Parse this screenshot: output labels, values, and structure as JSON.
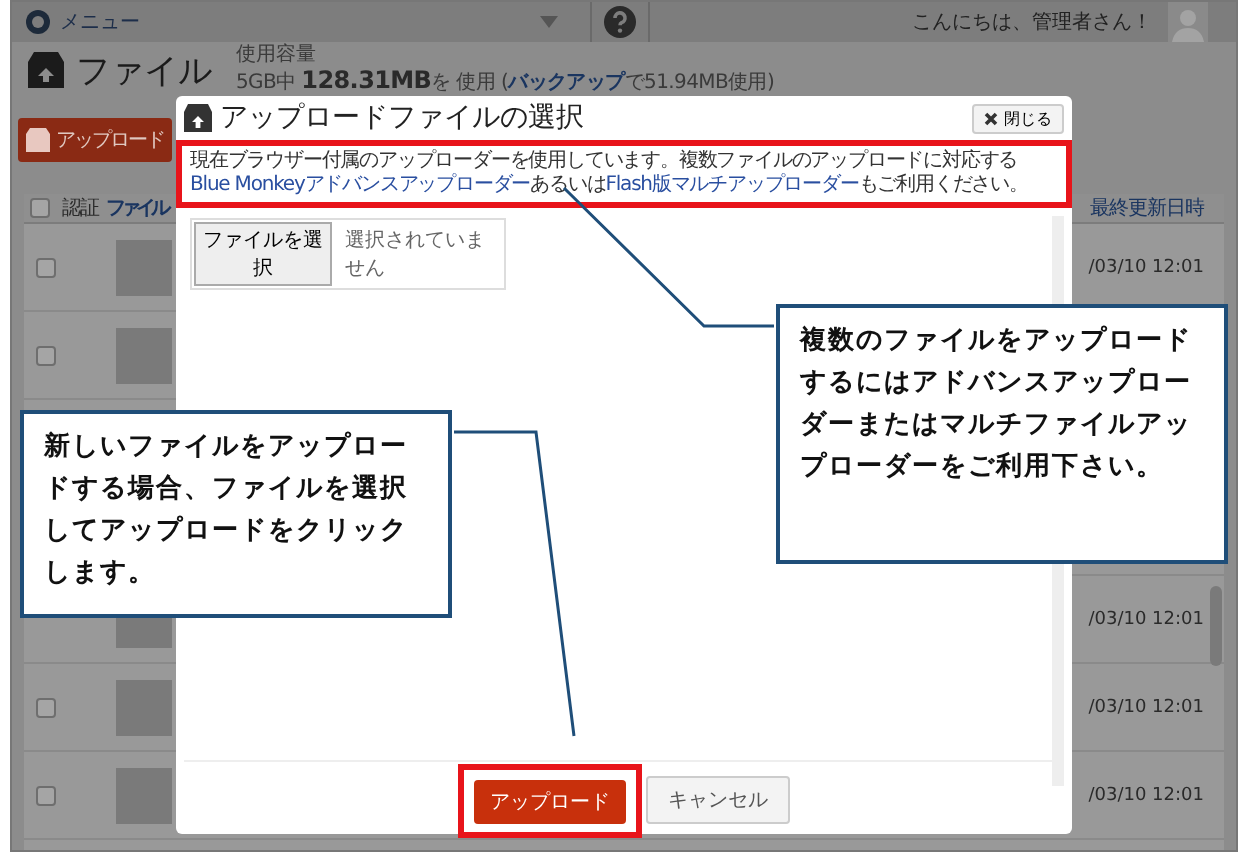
{
  "top_bar": {
    "menu_label": "メニュー",
    "greeting": "こんにちは、管理者さん！"
  },
  "header": {
    "title": "ファイル",
    "usage_label": "使用容量",
    "usage_text": "5GB中 **128.31MB**を 使用 (",
    "usage_link": "バックアップ",
    "usage_suffix": "で51.94MB使用)"
  },
  "upload_button": "アップロード",
  "table": {
    "all_checked": false,
    "columns": [
      "認証",
      "ファイル",
      "最終更新日時"
    ],
    "rows": [
      {
        "checked": false,
        "date": "/03/10 12:01"
      },
      {
        "checked": false
      },
      {},
      {},
      {
        "date": "/03/10 12:01"
      },
      {
        "checked": false,
        "date": "/03/10 12:01"
      },
      {
        "checked": false,
        "date": "/03/10 12:01"
      }
    ]
  },
  "dialog": {
    "title": "アップロードファイルの選択",
    "close_label": "閉じる",
    "notice": [
      {
        "kind": "text",
        "text": "現在ブラウザー付属のアップローダーを使用しています。複数ファイルのアップロードに対応する "
      },
      {
        "kind": "link",
        "text": "Blue Monkeyアドバンスアップローダー"
      },
      {
        "kind": "text",
        "text": "あるいは"
      },
      {
        "kind": "link",
        "text": "Flash版マルチアップローダー"
      },
      {
        "kind": "text",
        "text": "もご利用ください。"
      }
    ],
    "file_button": "ファイルを選択",
    "file_status": "選択されていません",
    "buttons": [
      {
        "label": "アップロード",
        "primary": true
      },
      {
        "label": "キャンセル",
        "primary": false
      }
    ]
  },
  "callouts": [
    {
      "text": "複数のファイルをアップロードするにはアドバンスアップローダーまたはマルチファイルアップローダーをご利用下さい。"
    },
    {
      "text": "新しいファイルをアップロードする場合、ファイルを選択してアップロードをクリックします。"
    }
  ]
}
